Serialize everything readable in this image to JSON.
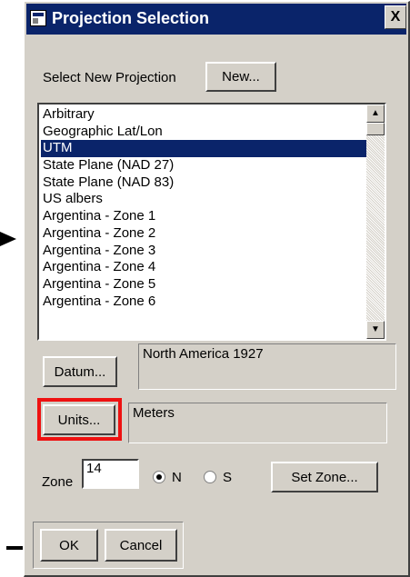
{
  "window": {
    "title": "Projection Selection",
    "close_glyph": "X"
  },
  "select_projection": {
    "label": "Select New Projection",
    "new_button": "New..."
  },
  "projection_list": {
    "items": [
      "Arbitrary",
      "Geographic Lat/Lon",
      "UTM",
      "State Plane (NAD 27)",
      "State Plane (NAD 83)",
      "US albers",
      "Argentina - Zone 1",
      "Argentina - Zone 2",
      "Argentina - Zone 3",
      "Argentina - Zone 4",
      "Argentina - Zone 5",
      "Argentina - Zone 6"
    ],
    "selected_index": 2,
    "scroll_up": "▲",
    "scroll_down": "▼"
  },
  "datum": {
    "button": "Datum...",
    "value": "North America 1927"
  },
  "units": {
    "button": "Units...",
    "value": "Meters"
  },
  "zone": {
    "label": "Zone",
    "value": "14",
    "radio_n": "N",
    "radio_s": "S",
    "selected_hemisphere": "N",
    "set_zone_button": "Set Zone..."
  },
  "footer": {
    "ok_button": "OK",
    "cancel_button": "Cancel"
  },
  "colors": {
    "dialog_bg": "#d4d0c8",
    "titlebar": "#0a246a",
    "selection": "#0a246a",
    "highlight": "#ee1111"
  }
}
